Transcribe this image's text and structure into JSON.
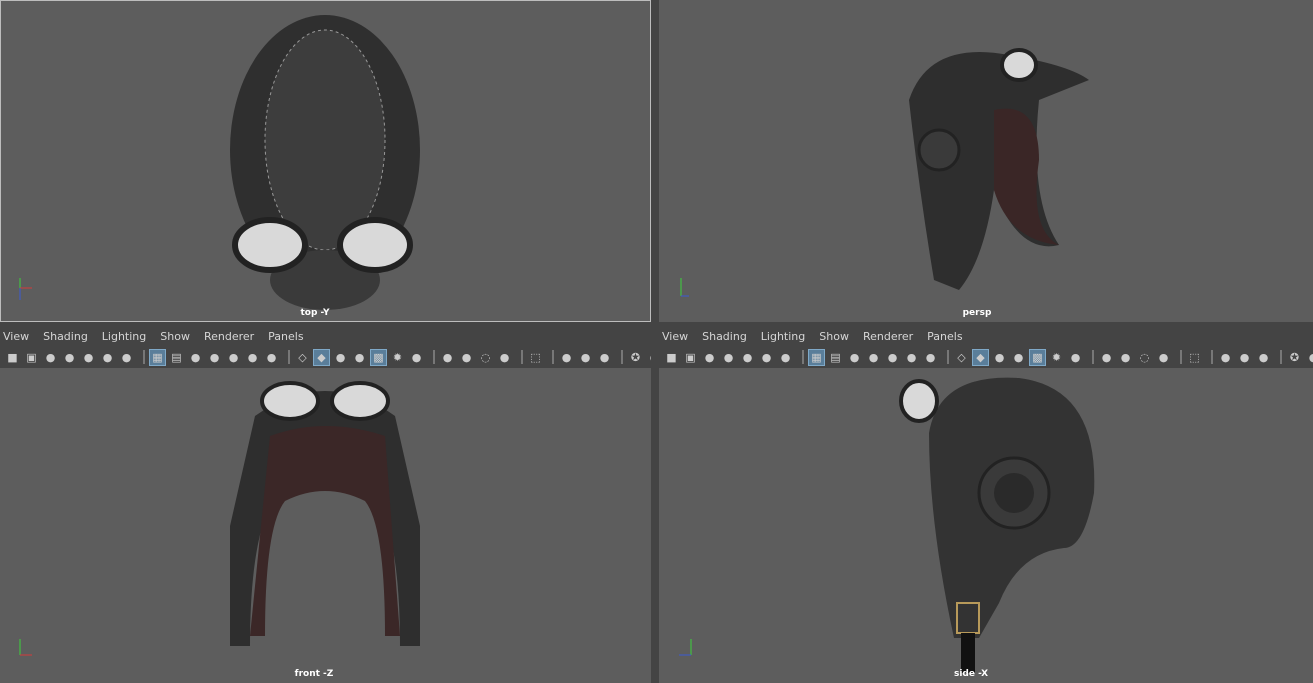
{
  "menus": [
    "View",
    "Shading",
    "Lighting",
    "Show",
    "Renderer",
    "Panels"
  ],
  "toolbar_icons": [
    {
      "icon": "camera-icon"
    },
    {
      "icon": "lock-camera-icon"
    },
    {
      "icon": "camera-attributes-icon"
    },
    {
      "icon": "bookmark-icon"
    },
    {
      "icon": "image-plane-icon"
    },
    {
      "icon": "2d-pan-zoom-icon"
    },
    {
      "icon": "grease-pencil-icon"
    },
    {
      "sep": true
    },
    {
      "icon": "grid-icon",
      "on": true
    },
    {
      "icon": "film-gate-icon"
    },
    {
      "icon": "resolution-gate-icon"
    },
    {
      "icon": "gate-mask-icon"
    },
    {
      "icon": "field-chart-icon"
    },
    {
      "icon": "safe-action-icon"
    },
    {
      "icon": "safe-title-icon"
    },
    {
      "sep": true
    },
    {
      "icon": "wireframe-icon"
    },
    {
      "icon": "smooth-shade-icon",
      "on": true
    },
    {
      "icon": "default-material-icon"
    },
    {
      "icon": "wireframe-on-shaded-icon"
    },
    {
      "icon": "textured-icon",
      "on": true
    },
    {
      "icon": "lights-icon"
    },
    {
      "icon": "shadows-icon"
    },
    {
      "sep": true
    },
    {
      "icon": "screen-space-ao-icon"
    },
    {
      "icon": "motion-blur-icon"
    },
    {
      "icon": "anti-alias-icon"
    },
    {
      "icon": "depth-of-field-icon"
    },
    {
      "sep": true
    },
    {
      "icon": "isolate-select-icon"
    },
    {
      "sep": true
    },
    {
      "icon": "xray-icon"
    },
    {
      "icon": "xray-active-icon"
    },
    {
      "icon": "xray-joints-icon"
    },
    {
      "sep": true
    },
    {
      "icon": "exposure-icon"
    },
    {
      "icon": "gamma-icon"
    }
  ],
  "viewports": [
    {
      "name": "top-left",
      "label": "top -Y",
      "axes": [
        "y",
        "x",
        "z"
      ]
    },
    {
      "name": "top-right",
      "label": "persp",
      "axes": [
        "y",
        "z",
        "x"
      ]
    },
    {
      "name": "bottom-left",
      "label": "front -Z",
      "axes": [
        "y",
        "x",
        "z"
      ]
    },
    {
      "name": "bottom-right",
      "label": "side -X",
      "axes": [
        "y",
        "z",
        "x"
      ]
    }
  ],
  "colors": {
    "viewport_bg": "#5d5d5d",
    "panel_bg": "#444444",
    "axis_x": "#d23a3a",
    "axis_y": "#3ad23a",
    "axis_z": "#3a5ad2",
    "active_toggle": "#5a7e9a"
  }
}
